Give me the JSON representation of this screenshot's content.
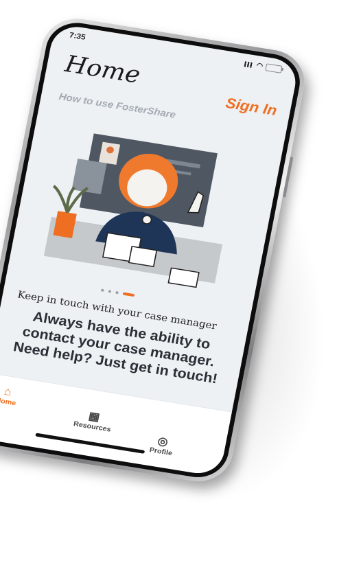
{
  "status_bar": {
    "time": "7:35"
  },
  "header": {
    "title": "Home",
    "subtitle": "How to use FosterShare",
    "sign_in_label": "Sign In"
  },
  "carousel": {
    "slide_title": "Keep in touch with your case manager",
    "slide_body": "Always have the ability to contact your case manager. Need help? Just get in touch!",
    "active_index": 3,
    "dot_count": 4
  },
  "tabbar": {
    "items": [
      {
        "label": "Home",
        "icon": "home-icon",
        "active": true
      },
      {
        "label": "Resources",
        "icon": "grid-icon",
        "active": false
      },
      {
        "label": "Profile",
        "icon": "user-icon",
        "active": false
      }
    ]
  },
  "colors": {
    "accent": "#ef6f22",
    "screen_bg": "#eef1f4",
    "text": "#2b2f36"
  }
}
